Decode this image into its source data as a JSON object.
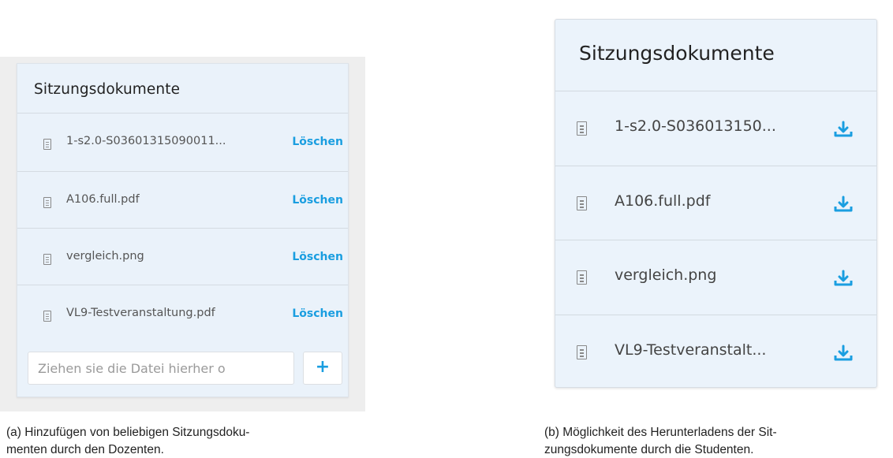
{
  "figure_a": {
    "title": "Sitzungsdokumente",
    "documents": [
      {
        "name": "1-s2.0-S03601315090011...",
        "action": "Löschen"
      },
      {
        "name": "A106.full.pdf",
        "action": "Löschen"
      },
      {
        "name": "vergleich.png",
        "action": "Löschen"
      },
      {
        "name": "VL9-Testveranstaltung.pdf",
        "action": "Löschen"
      }
    ],
    "upload_placeholder": "Ziehen sie die Datei hierher o",
    "add_button": "+",
    "caption_line1": "(a)  Hinzufügen von beliebigen Sitzungsdoku-",
    "caption_line2": "menten durch den Dozenten."
  },
  "figure_b": {
    "title": "Sitzungsdokumente",
    "documents": [
      {
        "name": "1-s2.0-S036013150..."
      },
      {
        "name": "A106.full.pdf"
      },
      {
        "name": "vergleich.png"
      },
      {
        "name": "VL9-Testveranstalt..."
      }
    ],
    "caption_line1": "(b)  Möglichkeit des Herunterladens der Sit-",
    "caption_line2": "zungsdokumente durch die Studenten."
  },
  "colors": {
    "accent": "#1a9ee0",
    "card_bg": "#eaf2fa"
  },
  "icons": {
    "file": "file-icon",
    "download": "download-icon"
  }
}
